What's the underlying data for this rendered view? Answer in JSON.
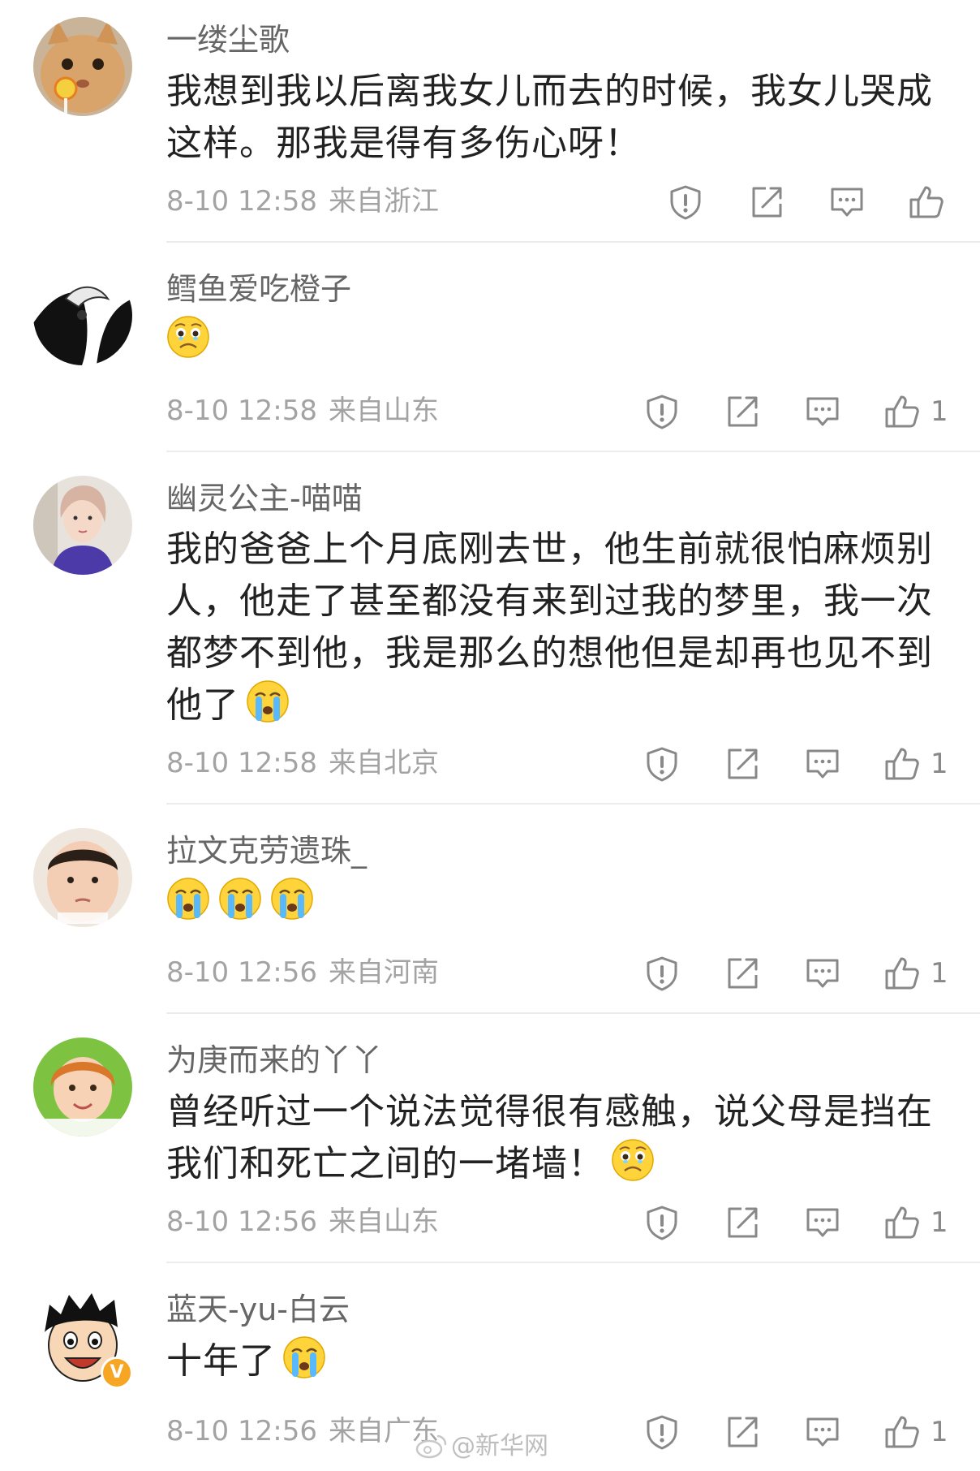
{
  "icons": {
    "report": "shield-exclamation-icon",
    "share": "share-icon",
    "reply": "comment-icon",
    "like": "thumbs-up-icon"
  },
  "colors": {
    "username": "#666666",
    "meta": "#a3a3a3",
    "icon": "#888888",
    "divider": "#ececec",
    "verified_badge": "#f6a623"
  },
  "comments": [
    {
      "username": "一缕尘歌",
      "lines": [
        "我想到我以后离我女儿而去的时候，我女儿哭成",
        "这样。那我是得有多伤心呀！"
      ],
      "emojis": [],
      "time": "8-10 12:58",
      "location": "来自浙江",
      "likes": ""
    },
    {
      "username": "鳕鱼爱吃橙子",
      "lines": [],
      "emojis": [
        "sad-face-emoji"
      ],
      "time": "8-10 12:58",
      "location": "来自山东",
      "likes": "1"
    },
    {
      "username": "幽灵公主-喵喵",
      "lines": [
        "我的爸爸上个月底刚去世，他生前就很怕麻烦别",
        "人，他走了甚至都没有来到过我的梦里，我一次",
        "都梦不到他，我是那么的想他但是却再也见不到",
        "他了"
      ],
      "emojis": [
        "crying-face-emoji"
      ],
      "time": "8-10 12:58",
      "location": "来自北京",
      "likes": "1"
    },
    {
      "username": "拉文克劳遗珠_",
      "lines": [],
      "emojis": [
        "crying-face-emoji",
        "crying-face-emoji",
        "crying-face-emoji"
      ],
      "time": "8-10 12:56",
      "location": "来自河南",
      "likes": "1"
    },
    {
      "username": "为庚而来的丫丫",
      "lines": [
        "曾经听过一个说法觉得很有感触，说父母是挡在",
        "我们和死亡之间的一堵墙！"
      ],
      "emojis": [
        "sad-face-emoji"
      ],
      "time": "8-10 12:56",
      "location": "来自山东",
      "likes": "1"
    },
    {
      "username": "蓝天-yu-白云",
      "lines": [
        "十年了"
      ],
      "emojis": [
        "crying-face-emoji"
      ],
      "time": "8-10 12:56",
      "location": "来自广东",
      "likes": "1",
      "verified": true
    }
  ],
  "watermark": "@新华网",
  "verified_badge_glyph": "V"
}
